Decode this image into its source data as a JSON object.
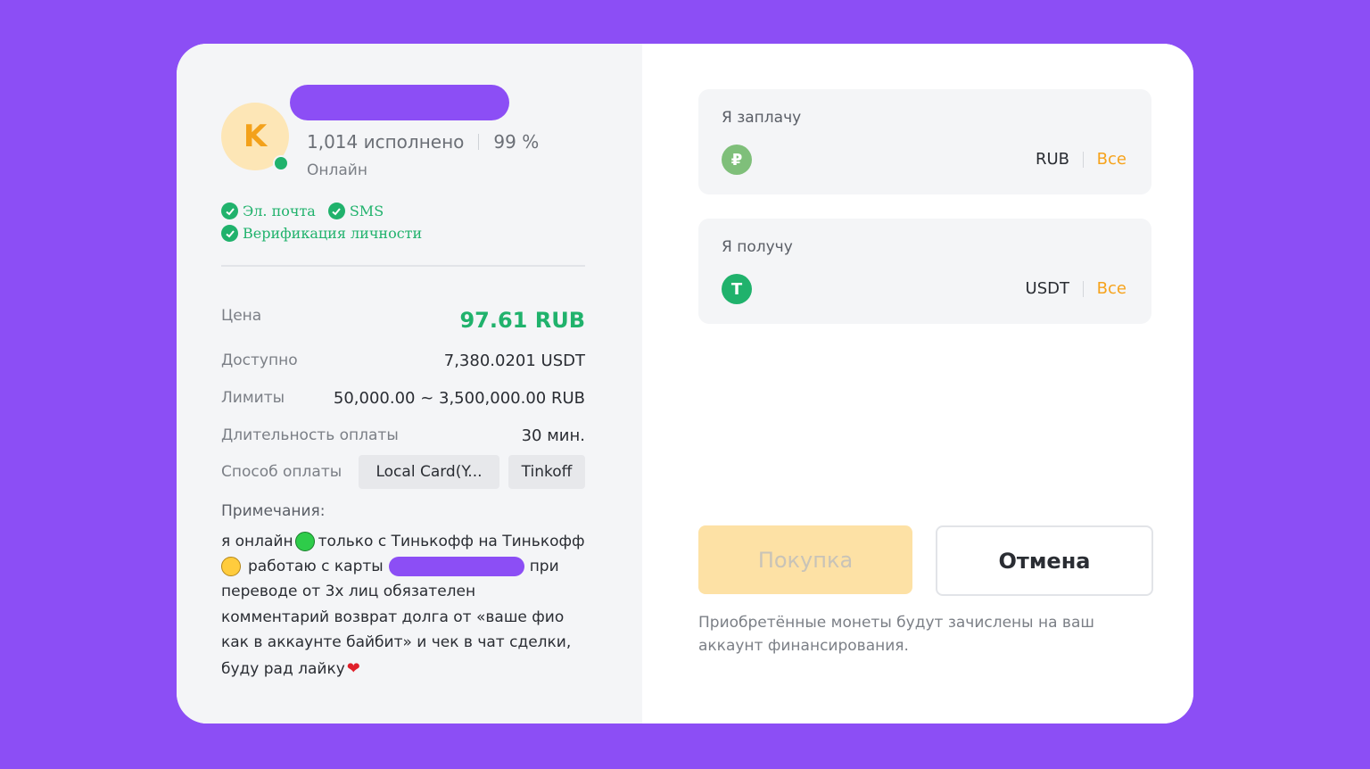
{
  "seller": {
    "avatar_letter": "K",
    "completed": "1,014 исполнено",
    "rate": "99 %",
    "status": "Онлайн",
    "verifications": [
      "Эл. почта",
      "SMS",
      "Верификация личности"
    ]
  },
  "offer": {
    "price_label": "Цена",
    "price_value": "97.61 RUB",
    "available_label": "Доступно",
    "available_value": "7,380.0201 USDT",
    "limits_label": "Лимиты",
    "limits_value": "50,000.00 ~ 3,500,000.00 RUB",
    "duration_label": "Длительность оплаты",
    "duration_value": "30 мин.",
    "payment_label": "Способ оплаты",
    "payment_methods": [
      "Local Card(Y...",
      "Tinkoff"
    ]
  },
  "notes": {
    "title": "Примечания:",
    "line1_a": "я онлайн",
    "line1_b": "только с Тинькофф на Тинькофф",
    "line2_a": "работаю с карты",
    "line2_b": "при",
    "line3": "переводе от 3х лиц обязателен",
    "line4": "комментарий возврат долга от «ваше фио",
    "line5": "как в аккаунте байбит» и чек в чат сделки,",
    "line6": "буду рад лайку"
  },
  "pay_box": {
    "label": "Я заплачу",
    "currency": "RUB",
    "all": "Все",
    "coin_symbol": "₽"
  },
  "get_box": {
    "label": "Я получу",
    "currency": "USDT",
    "all": "Все",
    "coin_symbol": "T"
  },
  "buttons": {
    "buy": "Покупка",
    "cancel": "Отмена"
  },
  "hint": "Приобретённые монеты будут зачислены на ваш аккаунт финансирования.",
  "colors": {
    "background": "#8c4ef5",
    "green": "#20b26c",
    "accent": "#f6a31c"
  }
}
